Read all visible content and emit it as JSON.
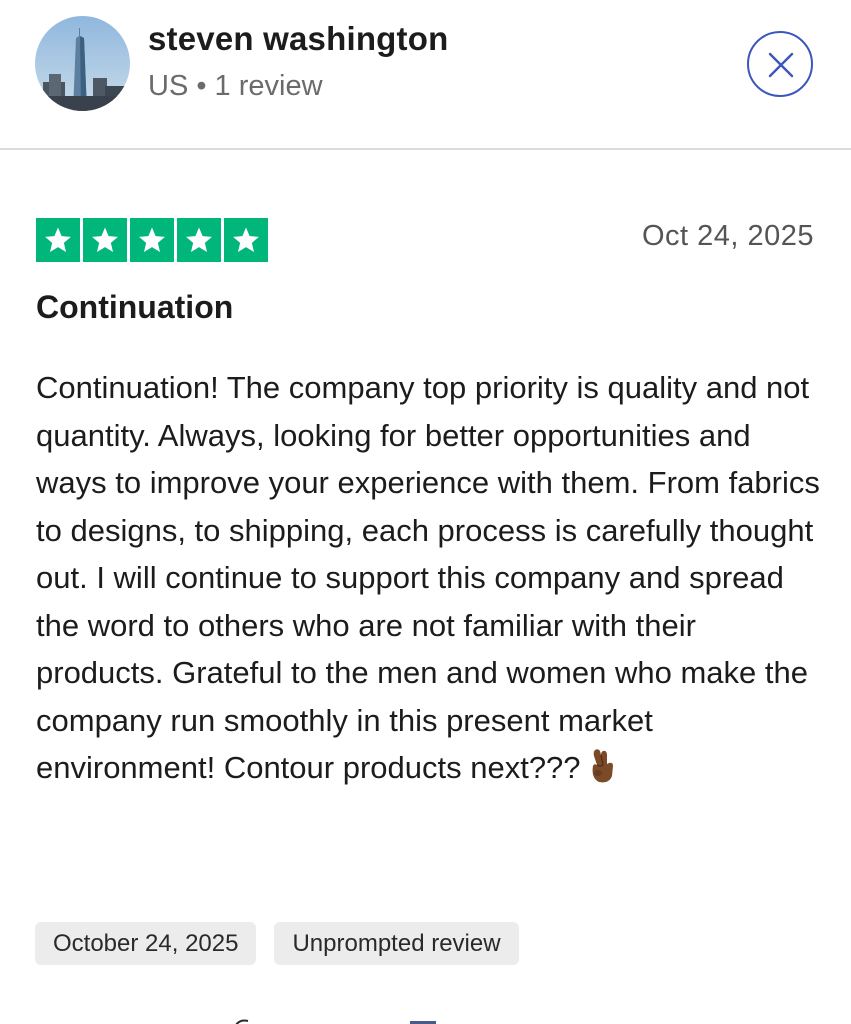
{
  "header": {
    "name": "steven washington",
    "meta": "US • 1 review",
    "avatar_icon": "city-skyline-avatar",
    "close_icon": "close-icon"
  },
  "review": {
    "rating_stars": 5,
    "rating_color": "#00b67a",
    "date_short": "Oct 24, 2025",
    "title": "Continuation",
    "body": "Continuation! The company top priority is quality and not quantity. Always, looking for better opportunities and ways to improve your experience with them. From fabrics to designs, to shipping, each process is carefully thought out. I will continue to support this company and spread the word to others who are not familiar with their products. Grateful to the men and women who make the company run smoothly in this present market environment! Contour products next???",
    "body_emoji": "crossed-fingers-icon"
  },
  "tags": [
    {
      "label": "October 24, 2025"
    },
    {
      "label": "Unprompted review"
    }
  ],
  "colors": {
    "accent_blue": "#3c57bc",
    "star_green": "#00b67a"
  }
}
